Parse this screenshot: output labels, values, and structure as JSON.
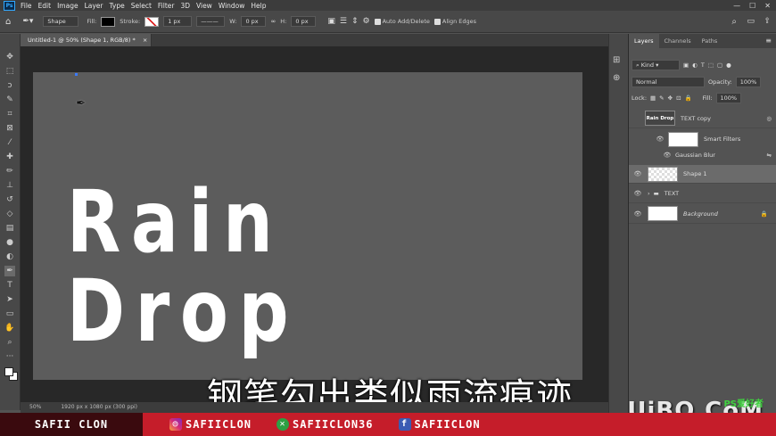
{
  "app": {
    "logo": "Ps"
  },
  "menu": [
    "File",
    "Edit",
    "Image",
    "Layer",
    "Type",
    "Select",
    "Filter",
    "3D",
    "View",
    "Window",
    "Help"
  ],
  "options": {
    "shape_mode": "Shape",
    "fill_label": "Fill:",
    "stroke_label": "Stroke:",
    "stroke_width": "1 px",
    "w_label": "W:",
    "w_value": "0 px",
    "h_label": "H:",
    "h_value": "0 px",
    "auto_add_delete": "Auto Add/Delete",
    "align_edges": "Align Edges",
    "fill_color": "#000000",
    "stroke_color": "#ffffff"
  },
  "document": {
    "tab_title": "Untitled-1 @ 50% (Shape 1, RGB/8) *",
    "close": "×",
    "canvas_text": "Rain Drop",
    "zoom": "50%",
    "doc_info": "1920 px x 1080 px (300 ppi)"
  },
  "subtitle": "钢笔勾出类似雨流痕迹",
  "panel": {
    "tabs": [
      "Layers",
      "Channels",
      "Paths"
    ],
    "filter_kind": "Kind",
    "blend_mode": "Normal",
    "opacity_label": "Opacity:",
    "opacity_value": "100%",
    "lock_label": "Lock:",
    "fill_label": "Fill:",
    "fill_value": "100%",
    "layers": {
      "text_copy": {
        "name": "TEXT copy",
        "thumb": "Rain Drop"
      },
      "smart_filters": "Smart Filters",
      "gaussian_blur": "Gaussian Blur",
      "shape1": "Shape 1",
      "text_group": "TEXT",
      "background": "Background"
    }
  },
  "banner": {
    "brand": "SAFII CLON",
    "instagram": "SAFIICLON",
    "xbox": "SAFIICLON36",
    "facebook": "SAFIICLON"
  },
  "watermark": {
    "main": "UiBQ.CoM",
    "sub": "PS爱好者"
  }
}
